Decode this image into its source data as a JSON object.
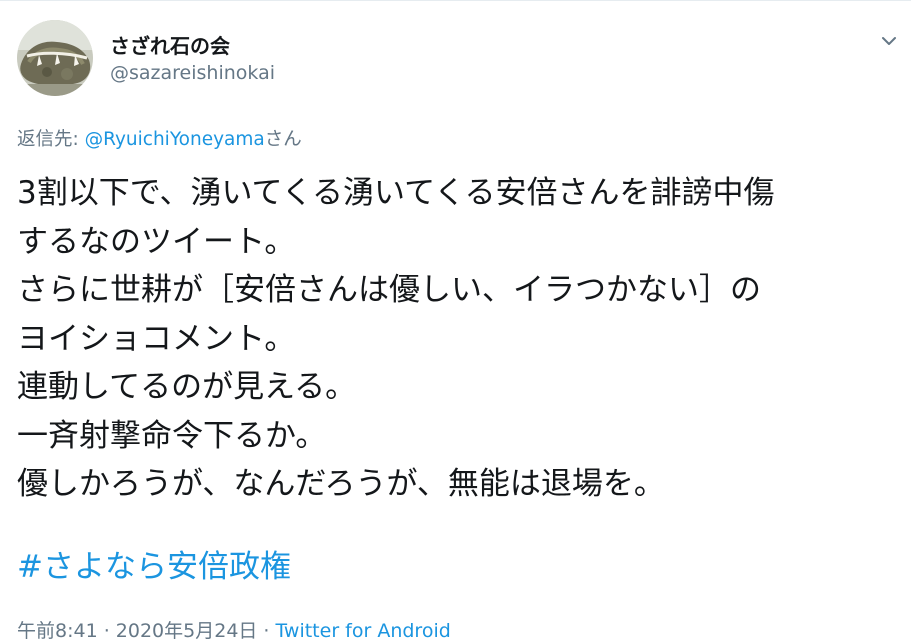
{
  "tweet": {
    "author": {
      "display_name": "さざれ石の会",
      "handle": "@sazareishinokai",
      "avatar_icon": "avatar-sazare-stone-photo"
    },
    "menu_icon": "chevron-down-icon",
    "reply_to": {
      "prefix": "返信先: ",
      "mention": "@RyuichiYoneyama",
      "suffix": "さん"
    },
    "body_lines": [
      "3割以下で、湧いてくる湧いてくる安倍さんを誹謗中傷",
      "するなのツイート。",
      "さらに世耕が［安倍さんは優しい、イラつかない］の",
      "ヨイショコメント。",
      "連動してるのが見える。",
      "一斉射撃命令下るか。",
      "優しかろうが、なんだろうが、無能は退場を。"
    ],
    "hashtag": "#さよなら安倍政権",
    "timestamp": "午前8:41 · 2020年5月24日",
    "separator": "·",
    "source": "Twitter for Android"
  },
  "colors": {
    "text": "#14171a",
    "secondary": "#657786",
    "link": "#1b95e0",
    "divider": "#e6ecf0"
  }
}
